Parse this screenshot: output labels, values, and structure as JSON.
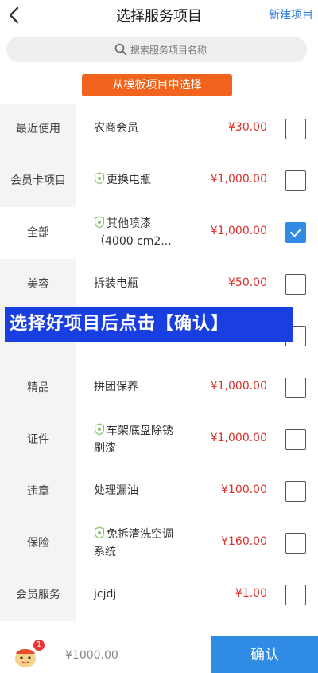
{
  "header": {
    "title": "选择服务项目",
    "new_item": "新建项目"
  },
  "search": {
    "placeholder": "搜索服务项目名称"
  },
  "template_button": "从模板项目中选择",
  "sidebar": {
    "items": [
      {
        "label": "最近使用"
      },
      {
        "label": "会员卡项目"
      },
      {
        "label": "全部"
      },
      {
        "label": "美容"
      },
      {
        "label": ""
      },
      {
        "label": "精品"
      },
      {
        "label": "证件"
      },
      {
        "label": "违章"
      },
      {
        "label": "保险"
      },
      {
        "label": "会员服务"
      }
    ],
    "active_index": 2
  },
  "services": [
    {
      "line1": "农商会员",
      "line2": "",
      "price": "¥30.00",
      "shield": false,
      "checked": false
    },
    {
      "line1": "更换电瓶",
      "line2": "",
      "price": "¥1,000.00",
      "shield": true,
      "checked": false
    },
    {
      "line1": "其他喷漆",
      "line2": "（4000 cm2...",
      "price": "¥1,000.00",
      "shield": true,
      "checked": true
    },
    {
      "line1": "拆装电瓶",
      "line2": "",
      "price": "¥50.00",
      "shield": false,
      "checked": false
    },
    {
      "line1": "",
      "line2": "",
      "price": "",
      "shield": false,
      "checked": false
    },
    {
      "line1": "拼团保养",
      "line2": "",
      "price": "¥1,000.00",
      "shield": false,
      "checked": false
    },
    {
      "line1": "车架底盘除锈",
      "line2": "刷漆",
      "price": "¥1,000.00",
      "shield": true,
      "checked": false
    },
    {
      "line1": "处理漏油",
      "line2": "",
      "price": "¥100.00",
      "shield": false,
      "checked": false
    },
    {
      "line1": "免拆清洗空调",
      "line2": "系统",
      "price": "¥160.00",
      "shield": true,
      "checked": false
    },
    {
      "line1": "jcjdj",
      "line2": "",
      "price": "¥1.00",
      "shield": false,
      "checked": false
    }
  ],
  "overlay_banner": "选择好项目后点击【确认】",
  "footer": {
    "cart_count": "1",
    "total": "¥1000.00",
    "confirm": "确认"
  },
  "colors": {
    "accent": "#2f8be3",
    "price": "#d9322c",
    "template_button": "#f2641e",
    "banner": "#1a3fe0"
  }
}
